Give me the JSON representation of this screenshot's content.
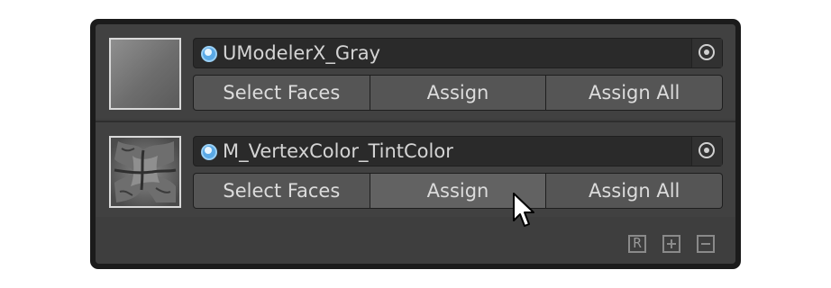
{
  "materials": [
    {
      "name": "UModelerX_Gray",
      "thumbnail_icon": "gray-gradient-swatch",
      "buttons": [
        "Select Faces",
        "Assign",
        "Assign All"
      ]
    },
    {
      "name": "M_VertexColor_TintColor",
      "thumbnail_icon": "stone-texture-swatch",
      "buttons": [
        "Select Faces",
        "Assign",
        "Assign All"
      ]
    }
  ],
  "footer": {
    "reset_label": "R",
    "add_icon": "plus-icon",
    "remove_icon": "minus-icon"
  },
  "colors": {
    "panel_bg": "#3e3e3e",
    "field_bg": "#2a2a2a",
    "button_bg": "#555555",
    "object_icon": "#5aa9e6"
  }
}
